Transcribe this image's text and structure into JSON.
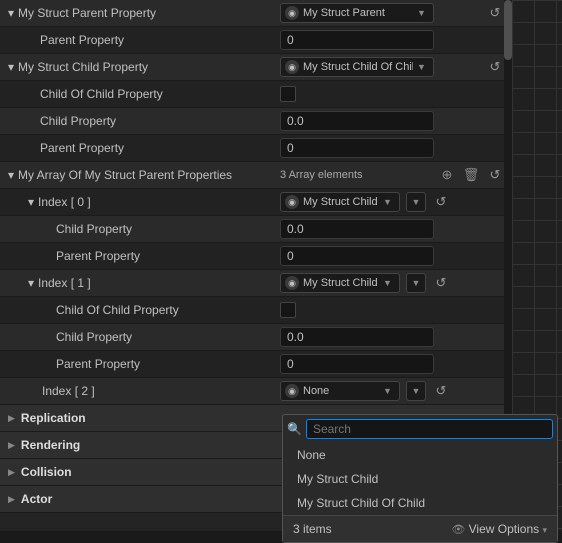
{
  "rows": {
    "r1_label": "My Struct Parent Property",
    "r1_value": "My Struct Parent",
    "r2_label": "Parent Property",
    "r2_value": "0",
    "r3_label": "My Struct Child Property",
    "r3_value": "My Struct Child Of Child",
    "r4_label": "Child Of Child Property",
    "r5_label": "Child Property",
    "r5_value": "0.0",
    "r6_label": "Parent Property",
    "r6_value": "0",
    "r7_label": "My Array Of My Struct Parent Properties",
    "r7_count": "3 Array elements",
    "r8_label": "Index [ 0 ]",
    "r8_value": "My Struct Child",
    "r9_label": "Child Property",
    "r9_value": "0.0",
    "r10_label": "Parent Property",
    "r10_value": "0",
    "r11_label": "Index [ 1 ]",
    "r11_value": "My Struct Child Of C",
    "r12_label": "Child Of Child Property",
    "r13_label": "Child Property",
    "r13_value": "0.0",
    "r14_label": "Parent Property",
    "r14_value": "0",
    "r15_label": "Index [ 2 ]",
    "r15_value": "None"
  },
  "sections": {
    "replication": "Replication",
    "rendering": "Rendering",
    "collision": "Collision",
    "actor": "Actor"
  },
  "dropdown": {
    "search_placeholder": "Search",
    "opt1": "None",
    "opt2": "My Struct Child",
    "opt3": "My Struct Child Of Child",
    "count": "3 items",
    "view_options": "View Options"
  }
}
